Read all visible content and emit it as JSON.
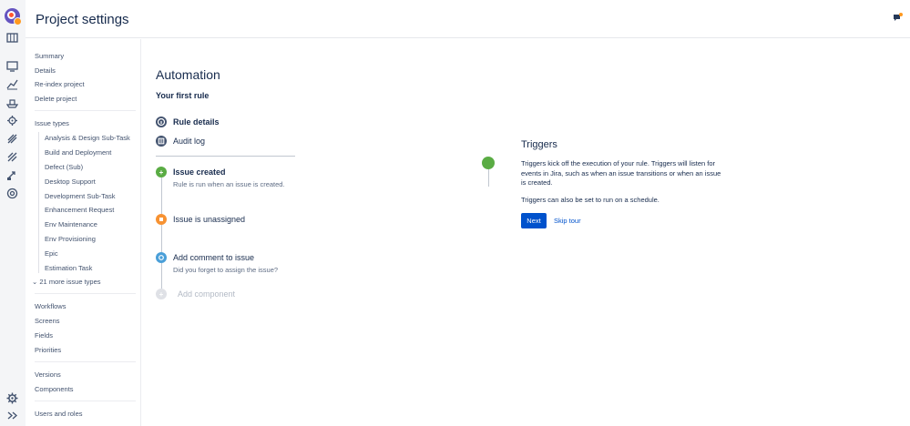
{
  "header": {
    "title": "Project settings"
  },
  "rail": {
    "icons": [
      "product-logo-icon",
      "board-icon",
      "backlog-icon",
      "reports-icon",
      "releases-icon",
      "components-icon",
      "add-item-icon",
      "pages-icon",
      "shortcut-icon",
      "settings-icon",
      "expand-icon"
    ]
  },
  "sidebar": {
    "items_top": [
      "Summary",
      "Details",
      "Re-index project",
      "Delete project"
    ],
    "issue_types_label": "Issue types",
    "issue_types": [
      "Analysis & Design Sub-Task",
      "Build and Deployment",
      "Defect (Sub)",
      "Desktop Support",
      "Development Sub-Task",
      "Enhancement Request",
      "Env Maintenance",
      "Env Provisioning",
      "Epic",
      "Estimation Task"
    ],
    "more_types": "21 more issue types",
    "items_schemes": [
      "Workflows",
      "Screens",
      "Fields",
      "Priorities"
    ],
    "items_versions": [
      "Versions",
      "Components"
    ],
    "items_users": [
      "Users and roles"
    ]
  },
  "main": {
    "heading": "Automation",
    "subheading": "Your first rule",
    "nav": [
      {
        "label": "Rule details",
        "icon": "info-icon"
      },
      {
        "label": "Audit log",
        "icon": "list-icon"
      }
    ],
    "steps": [
      {
        "label": "Issue created",
        "desc": "Rule is run when an issue is created.",
        "color": "#5aac44",
        "icon": "plus-icon"
      },
      {
        "label": "Issue is unassigned",
        "desc": "",
        "color": "#f79232",
        "icon": "condition-icon"
      },
      {
        "label": "Add comment to issue",
        "desc": "Did you forget to assign the issue?",
        "color": "#4a9fd8",
        "icon": "action-icon"
      }
    ],
    "add_component": "Add component"
  },
  "tour": {
    "title": "Triggers",
    "text": "Triggers kick off the execution of your rule. Triggers will listen for events in Jira, such as when an issue transitions or when an issue is created.",
    "text2": "Triggers can also be set to run on a schedule.",
    "next": "Next",
    "skip": "Skip tour",
    "accent": "#0052cc",
    "dot_color": "#5aac44"
  }
}
